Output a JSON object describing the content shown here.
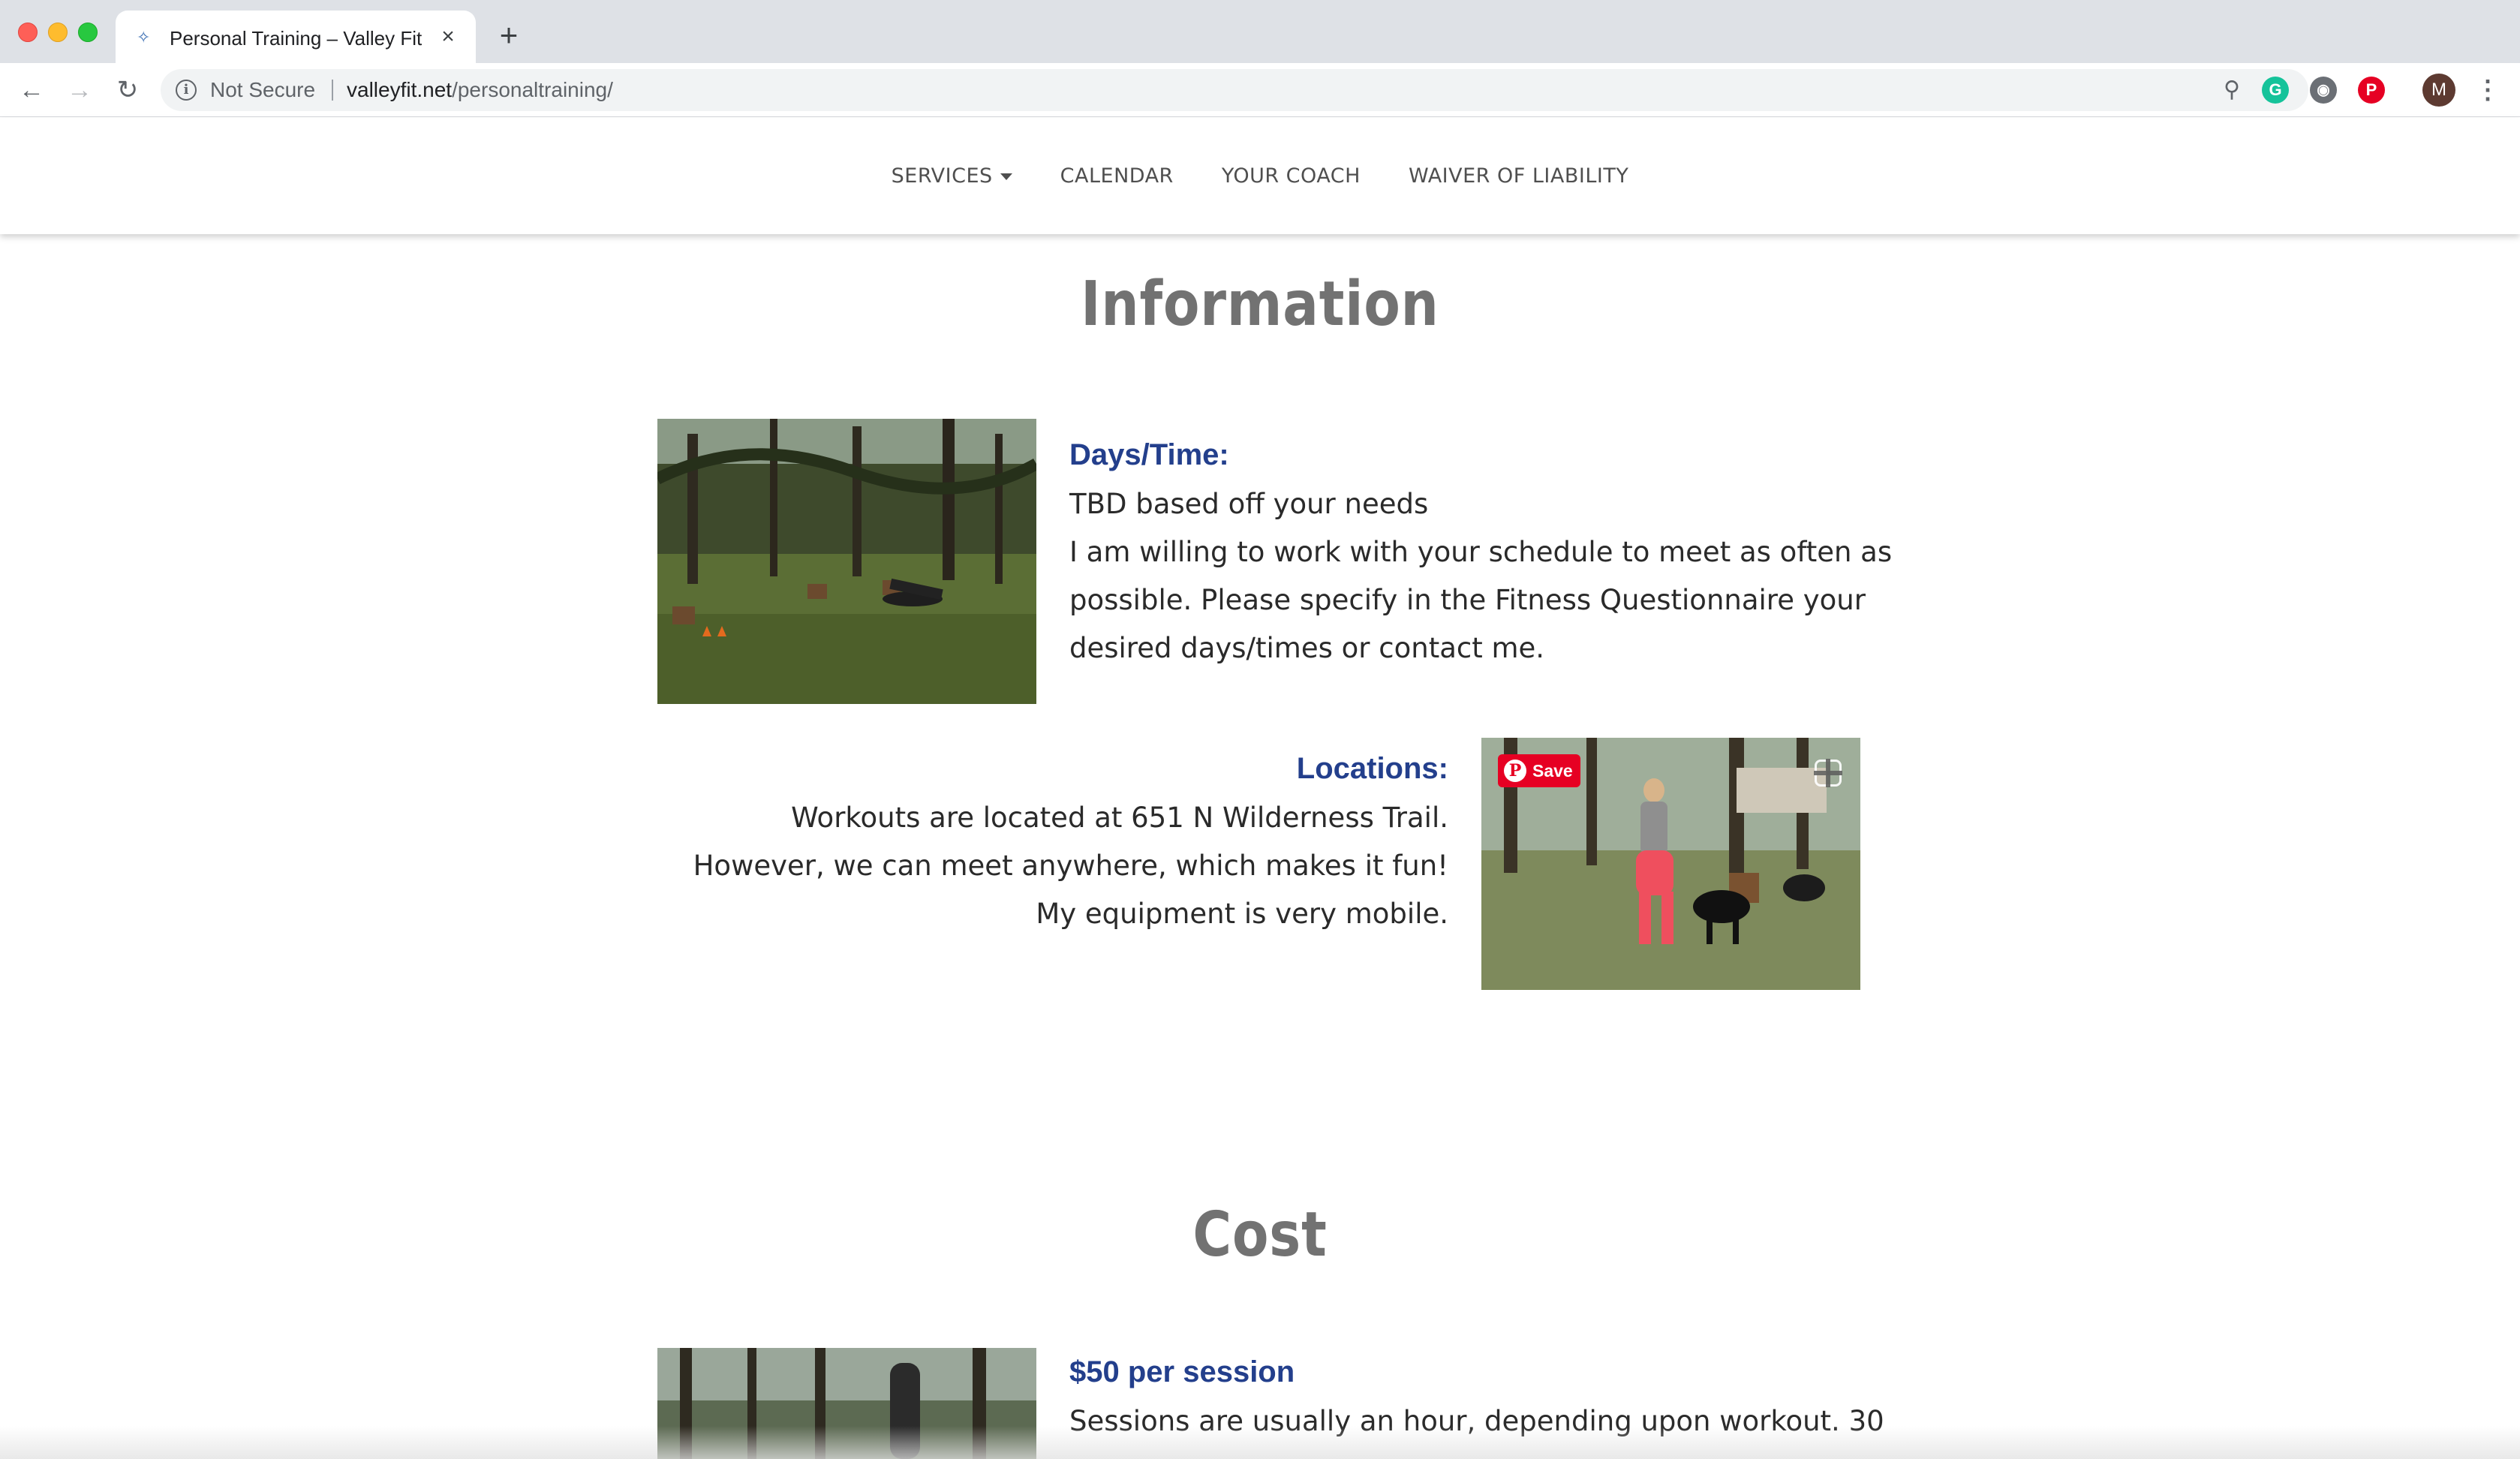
{
  "browser": {
    "tab_title": "Personal Training – Valley Fit Studio",
    "not_secure": "Not Secure",
    "url_host": "valleyfit.net",
    "url_path": "/personaltraining/",
    "profile_initial": "M"
  },
  "nav": {
    "services": "SERVICES",
    "calendar": "CALENDAR",
    "your_coach": "YOUR COACH",
    "waiver": "WAIVER OF LIABILITY"
  },
  "information": {
    "heading": "Information",
    "days_label": "Days/Time:",
    "days_line1": "TBD based off your needs",
    "days_line2": "I am willing to work with your schedule to meet as often as",
    "days_line3": "possible. Please specify in the Fitness Questionnaire your",
    "days_line4": "desired days/times or contact me.",
    "locations_label": "Locations:",
    "locations_line1": "Workouts are located at 651 N Wilderness Trail.",
    "locations_line2": "However, we can meet anywhere, which makes it fun!",
    "locations_line3": "My equipment is very mobile.",
    "pin_save": "Save"
  },
  "cost": {
    "heading": "Cost",
    "price_label": "$50 per session",
    "line1": "Sessions are usually an hour, depending upon workout. 30"
  },
  "colors": {
    "label_blue": "#233f8c",
    "heading_gray": "#727272",
    "pinterest_red": "#e60023"
  }
}
